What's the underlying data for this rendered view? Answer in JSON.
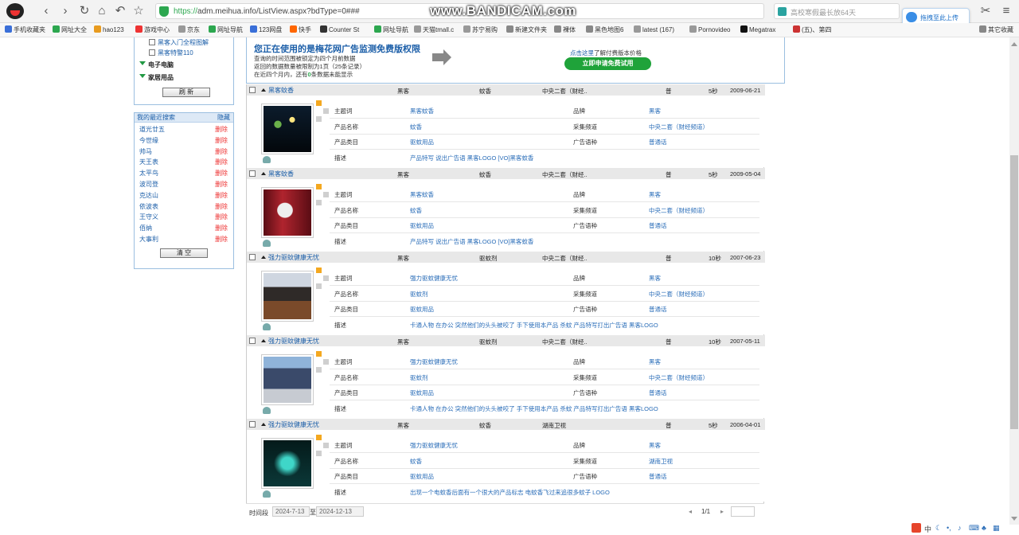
{
  "browser": {
    "url_scheme": "https://",
    "url_rest": "adm.meihua.info/ListView.aspx?bdType=0###",
    "watermark": "www.BANDICAM.com",
    "search_text": "高校寒假最长放64天",
    "upload_label": "拖拽至此上传"
  },
  "bookmarks": [
    {
      "label": "手机收藏夹",
      "color": "#3a6fd8"
    },
    {
      "label": "网址大全",
      "color": "#2ca74f"
    },
    {
      "label": "hao123",
      "color": "#e89b1f"
    },
    {
      "label": "游戏中心",
      "color": "#e33"
    },
    {
      "label": "京东",
      "color": "#999"
    },
    {
      "label": "网址导航",
      "color": "#2ca74f"
    },
    {
      "label": "123网盘",
      "color": "#3a6fd8"
    },
    {
      "label": "快手",
      "color": "#f60"
    },
    {
      "label": "Counter St",
      "color": "#333"
    },
    {
      "label": "网址导航",
      "color": "#2ca74f"
    },
    {
      "label": "天猫tmall.c",
      "color": "#999"
    },
    {
      "label": "苏宁易购",
      "color": "#999"
    },
    {
      "label": "新建文件夹",
      "color": "#888"
    },
    {
      "label": "裸体",
      "color": "#888"
    },
    {
      "label": "黑色地图6",
      "color": "#888"
    },
    {
      "label": "latest (167)",
      "color": "#999"
    },
    {
      "label": "Pornovideo",
      "color": "#999"
    },
    {
      "label": "Megatrax",
      "color": "#111"
    },
    {
      "label": "(五)、第四",
      "color": "#c33"
    },
    {
      "label": "其它收藏",
      "color": "#888"
    }
  ],
  "sidebar": {
    "category_items": [
      "黑客入门全程图解",
      "黑客特警110"
    ],
    "groups": [
      "电子电脑",
      "家居用品"
    ],
    "refresh_label": "刷 新",
    "recent_title": "我的最近搜索",
    "hide_label": "隐藏",
    "recent": [
      "道光廿五",
      "今世缘",
      "帅马",
      "天王表",
      "太平鸟",
      "波司登",
      "克达山",
      "依波表",
      "王守义",
      "佰纳",
      "大事利"
    ],
    "delete_label": "删除",
    "clear_label": "清 空"
  },
  "banner": {
    "title": "您正在使用的是梅花网广告监测免费版权限",
    "lines": [
      "查询的时间范围被锁定为四个月前数据",
      "返回的数据数量被限制为1页（25条记录）"
    ],
    "line3_a": "在近四个月内，还有",
    "line3_num": "0",
    "line3_b": "条数据未能显示",
    "note_link": "点击这里",
    "note_rest": "了解付费版本价格",
    "apply_label": "立即申请免费试用"
  },
  "labels": {
    "theme": "主题词",
    "product_name": "产品名称",
    "category": "产品类目",
    "desc": "描述",
    "brand": "品牌",
    "channel": "采集频道",
    "language": "广告语种"
  },
  "records": [
    {
      "title": "黑客蚊香",
      "brand": "黑客",
      "product": "蚊香",
      "channel_short": "中央二套（财经..",
      "lang": "普",
      "duration": "5秒",
      "date": "2009-06-21",
      "theme": "黑客蚊香",
      "product_name": "蚊香",
      "category": "驱蚊用品",
      "desc": "产品特写 说出广告语 黑客LOGO [VO]黑客蚊香",
      "brand_full": "黑客",
      "channel_full": "中央二套（财经频道）",
      "language": "普通话"
    },
    {
      "title": "黑客蚊香",
      "brand": "黑客",
      "product": "蚊香",
      "channel_short": "中央二套（财经..",
      "lang": "普",
      "duration": "5秒",
      "date": "2009-05-04",
      "theme": "黑客蚊香",
      "product_name": "蚊香",
      "category": "驱蚊用品",
      "desc": "产品特写 说出广告语 黑客LOGO [VO]黑客蚊香",
      "brand_full": "黑客",
      "channel_full": "中央二套（财经频道）",
      "language": "普通话"
    },
    {
      "title": "强力驱蚊健康无忧",
      "brand": "黑客",
      "product": "驱蚊剂",
      "channel_short": "中央二套（财经..",
      "lang": "普",
      "duration": "10秒",
      "date": "2007-06-23",
      "theme": "强力驱蚊健康无忧",
      "product_name": "驱蚊剂",
      "category": "驱蚊用品",
      "desc": "卡通人物 在办公 突然他们的头头被咬了 手下使用本产品 杀蚊 产品特写打出广告语 黑客LOGO",
      "brand_full": "黑客",
      "channel_full": "中央二套（财经频道）",
      "language": "普通话"
    },
    {
      "title": "强力驱蚊健康无忧",
      "brand": "黑客",
      "product": "驱蚊剂",
      "channel_short": "中央二套（财经..",
      "lang": "普",
      "duration": "10秒",
      "date": "2007-05-11",
      "theme": "强力驱蚊健康无忧",
      "product_name": "驱蚊剂",
      "category": "驱蚊用品",
      "desc": "卡通人物 在办公 突然他们的头头被咬了 手下使用本产品 杀蚊 产品特写打出广告语 黑客LOGO",
      "brand_full": "黑客",
      "channel_full": "中央二套（财经频道）",
      "language": "普通话"
    },
    {
      "title": "强力驱蚊健康无忧",
      "brand": "黑客",
      "product": "蚊香",
      "channel_short": "湖南卫视",
      "lang": "普",
      "duration": "5秒",
      "date": "2006-04-01",
      "theme": "强力驱蚊健康无忧",
      "product_name": "蚊香",
      "category": "驱蚊用品",
      "desc": "出现一个电蚊香后面有一个很大的产品标志 电蚊香飞过来追很多蚊子 LOGO",
      "brand_full": "黑客",
      "channel_full": "湖南卫视",
      "language": "普通话"
    }
  ],
  "footer": {
    "period_label": "时间段",
    "date_from": "2024-7-13",
    "to_label": "至",
    "date_to": "2024-12-13",
    "pages": "1/1"
  },
  "tray": {
    "ime": "中"
  }
}
